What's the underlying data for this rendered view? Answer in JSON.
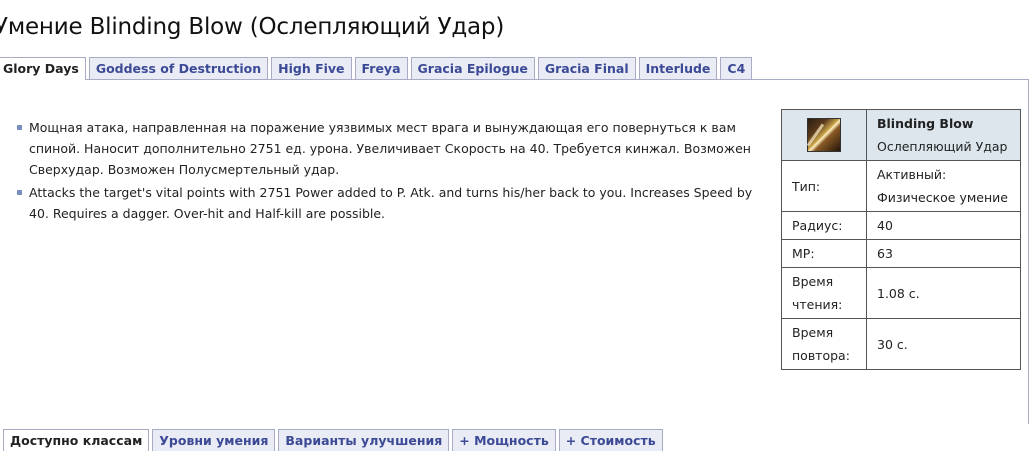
{
  "page_title": "Умение Blinding Blow (Ослепляющий Удар)",
  "version_tabs": [
    {
      "label": "Glory Days",
      "active": true
    },
    {
      "label": "Goddess of Destruction",
      "active": false
    },
    {
      "label": "High Five",
      "active": false
    },
    {
      "label": "Freya",
      "active": false
    },
    {
      "label": "Gracia Epilogue",
      "active": false
    },
    {
      "label": "Gracia Final",
      "active": false
    },
    {
      "label": "Interlude",
      "active": false
    },
    {
      "label": "C4",
      "active": false
    }
  ],
  "description": [
    "Мощная атака, направленная на поражение уязвимых мест врага и вынуждающая его повернуться к вам спиной. Наносит дополнительно 2751 ед. урона. Увеличивает Скорость на 40. Требуется кинжал. Возможен Сверхудар. Возможен Полусмертельный удар.",
    "Attacks the target's vital points with 2751 Power added to P. Atk. and turns his/her back to you. Increases Speed by 40. Requires a dagger. Over-hit and Half-kill are possible."
  ],
  "info": {
    "icon": "blinding-blow-skill-icon",
    "name_en": "Blinding Blow",
    "name_ru": "Ослепляющий Удар",
    "rows": [
      {
        "label": "Тип:",
        "value": "Активный: Физическое умение"
      },
      {
        "label": "Радиус:",
        "value": "40"
      },
      {
        "label": "MP:",
        "value": "63"
      },
      {
        "label": "Время чтения:",
        "value": "1.08 с."
      },
      {
        "label": "Время повтора:",
        "value": "30 с."
      }
    ]
  },
  "bottom_tabs": [
    {
      "label": "Доступно классам",
      "active": true
    },
    {
      "label": "Уровни умения",
      "active": false
    },
    {
      "label": "Варианты улучшения",
      "active": false
    },
    {
      "label": "+ Мощность",
      "active": false
    },
    {
      "label": "+ Стоимость",
      "active": false
    }
  ]
}
